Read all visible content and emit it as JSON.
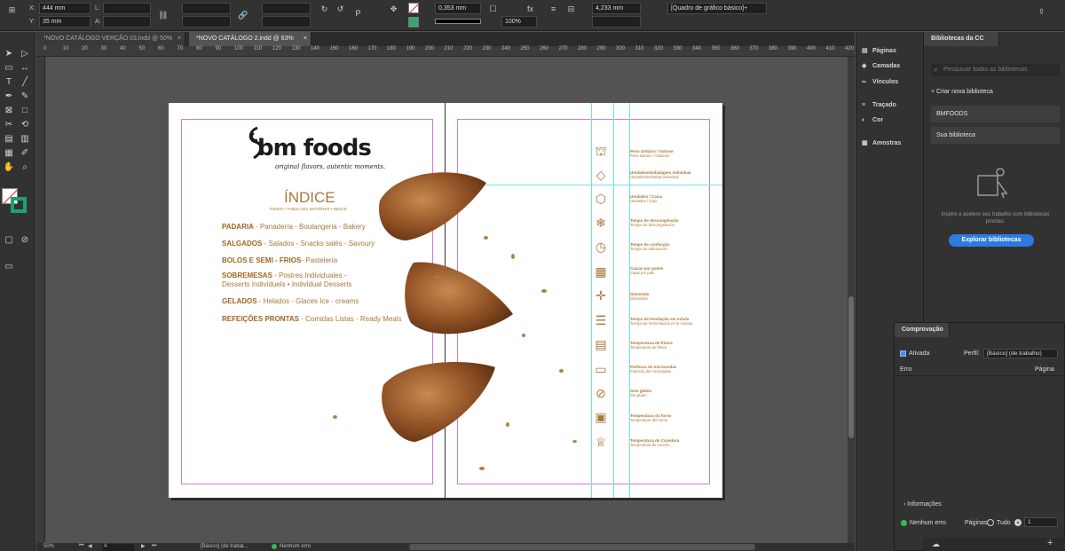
{
  "control_bar": {
    "x_label": "X:",
    "x_value": "444 mm",
    "y_label": "Y:",
    "y_value": "35 mm",
    "l_label": "L:",
    "a_label": "A:",
    "stroke_weight": "0,353 mm",
    "zoom": "100%",
    "spacing": "4,233 mm",
    "frame_style": "[Quadro de gráfico básico]+"
  },
  "doc_tabs": [
    {
      "label": "*NOVO CATÁLOGO VERÇÃO 03.indd @ 50%"
    },
    {
      "label": "*NOVO CATÁLOGO 2.indd @ 63%"
    }
  ],
  "ruler_ticks": [
    "0",
    "10",
    "20",
    "30",
    "40",
    "50",
    "60",
    "70",
    "80",
    "90",
    "100",
    "110",
    "120",
    "130",
    "140",
    "150",
    "160",
    "170",
    "180",
    "190",
    "200",
    "210",
    "220",
    "230",
    "240",
    "250",
    "260",
    "270",
    "280",
    "290",
    "300",
    "310",
    "320",
    "330",
    "340",
    "350",
    "360",
    "370",
    "380",
    "390",
    "400",
    "410",
    "420"
  ],
  "page_left": {
    "brand": "bm foods",
    "tagline": "original flavors, autentic moments.",
    "index_title": "ÍNDICE",
    "index_subtitle": "ÍNDICE • TABLE DES MATIÈRES • INDICE",
    "sections": [
      {
        "name": "PADARIA",
        "rest": " - Panadería - Boulangeria - Bakery"
      },
      {
        "name": "SALGADOS",
        "rest": " - Salados - Snacks salés - Savoury"
      },
      {
        "name": "BOLOS E SEMI - FRIOS",
        "rest": "- Pastelería"
      },
      {
        "name": "SOBREMESAS",
        "rest": " - Postres Individuales -"
      },
      {
        "name": "",
        "rest": "Desserts Individuels • Individual Desserts"
      },
      {
        "name": "GELADOS",
        "rest": " - Helados - Glaces  Ice - creams"
      },
      {
        "name": "REFEIÇÕES PRONTAS",
        "rest": " - Comidas Listas - Ready Meals"
      }
    ]
  },
  "page_right": {
    "specs": [
      {
        "icon": "scale-icon",
        "title": "Peso Unitário / Volume",
        "sub": "Peso unitario / Volumen"
      },
      {
        "icon": "package-icon",
        "title": "Unidades/embalagem individual",
        "sub": "Unidades/embalaje individual"
      },
      {
        "icon": "box-icon",
        "title": "Unidades / Caixa",
        "sub": "Unidades / Caja"
      },
      {
        "icon": "snowflake-icon",
        "title": "Tempo de descongelação",
        "sub": "Tiempo de descongelación"
      },
      {
        "icon": "clock-icon",
        "title": "Tempo de confecção",
        "sub": "Tiempo de elaboración"
      },
      {
        "icon": "pallet-icon",
        "title": "Caixas por palete",
        "sub": "Cajas por palé"
      },
      {
        "icon": "dimension-icon",
        "title": "Dimensão",
        "sub": "Dimensión"
      },
      {
        "icon": "proofing-icon",
        "title": "Tempo de levedação em estufa",
        "sub": "Tiempo de fermentación en la cámara"
      },
      {
        "icon": "fryer-icon",
        "title": "Temperatura de fritura",
        "sub": "Temperatura de fritura"
      },
      {
        "icon": "microwave-icon",
        "title": "Potência do microondas",
        "sub": "Potencia del microondas"
      },
      {
        "icon": "gluten-free-icon",
        "title": "Sem glúten",
        "sub": "Sin gluten"
      },
      {
        "icon": "oven-icon",
        "title": "Temperatura do forno",
        "sub": "Temperatura del horno"
      },
      {
        "icon": "chef-icon",
        "title": "Temperatura de Cozedura",
        "sub": "Temperatura de cocción"
      }
    ]
  },
  "status_bar": {
    "zoom": "50%",
    "page": "4",
    "profile": "[Básico] (de trabal...",
    "errors": "Nenhum erro"
  },
  "collapsed_panels": [
    "Páginas",
    "Camadas",
    "Vínculos",
    "Traçado",
    "Cor",
    "Amostras"
  ],
  "cc_libraries": {
    "tab": "Bibliotecas da CC",
    "search_placeholder": "Pesquisar todas as bibliotecas",
    "create": "Criar nova biblioteca",
    "libraries": [
      "BMFOODS",
      "Sua biblioteca"
    ],
    "promo": "Inspire e acelere seu trabalho com bibliotecas prontas.",
    "explore": "Explorar bibliotecas"
  },
  "preflight": {
    "tab": "Comprovação",
    "active": "Ativada",
    "profile_label": "Perfil:",
    "profile_value": "[Básico] (de trabalho)",
    "col_error": "Erro",
    "col_page": "Página",
    "info": "Informações",
    "status": "Nenhum erro",
    "pages_label": "Páginas:",
    "all": "Tudo",
    "pages_value": "1"
  }
}
